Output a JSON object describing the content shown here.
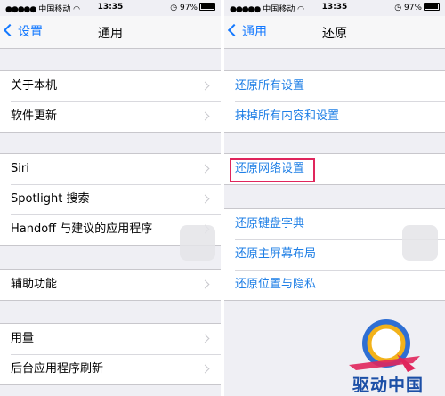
{
  "status_bar": {
    "carrier": "中国移动",
    "time": "13:35",
    "battery": "97%"
  },
  "left_screen": {
    "back_label": "设置",
    "title": "通用",
    "group1": [
      "关于本机",
      "软件更新"
    ],
    "group2": [
      "Siri",
      "Spotlight 搜索",
      "Handoff 与建议的应用程序"
    ],
    "group3": [
      "辅助功能"
    ],
    "group4": [
      "用量",
      "后台应用程序刷新"
    ]
  },
  "right_screen": {
    "back_label": "通用",
    "title": "还原",
    "group1": [
      "还原所有设置",
      "抹掉所有内容和设置"
    ],
    "group2": [
      "还原网络设置"
    ],
    "group3": [
      "还原键盘字典",
      "还原主屏幕布局",
      "还原位置与隐私"
    ]
  },
  "watermark": {
    "text": "驱动中国"
  },
  "colors": {
    "ios_blue": "#1479ff",
    "highlight_border": "#e0265c",
    "background": "#efeff4"
  }
}
